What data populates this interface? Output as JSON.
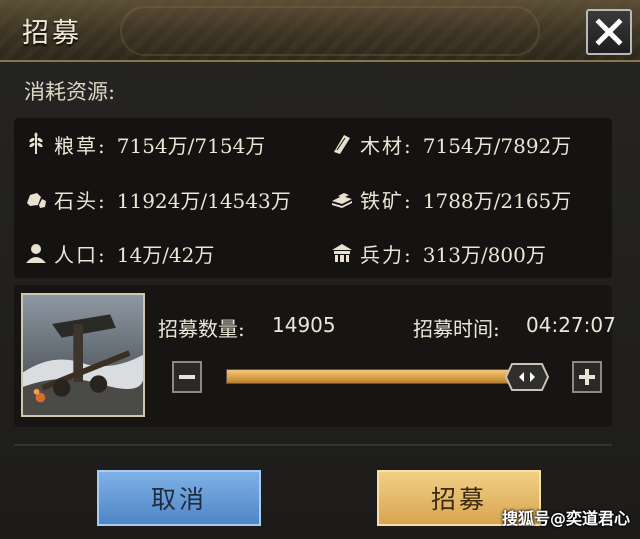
{
  "dialog": {
    "title": "招募",
    "close_icon": "close-icon"
  },
  "cost": {
    "label": "消耗资源:"
  },
  "resources": [
    {
      "icon": "grain-icon",
      "label": "粮草:",
      "value": "7154万/7154万"
    },
    {
      "icon": "wood-icon",
      "label": "木材:",
      "value": "7154万/7892万"
    },
    {
      "icon": "stone-icon",
      "label": "石头:",
      "value": "11924万/14543万"
    },
    {
      "icon": "iron-ore-icon",
      "label": "铁矿:",
      "value": "1788万/2165万"
    },
    {
      "icon": "population-icon",
      "label": "人口:",
      "value": "14万/42万"
    },
    {
      "icon": "troops-icon",
      "label": "兵力:",
      "value": "313万/800万"
    }
  ],
  "recruit": {
    "quantity_label": "招募数量:",
    "quantity_value": "14905",
    "time_label": "招募时间:",
    "time_value": "04:27:07",
    "slider_fraction": 0.9
  },
  "buttons": {
    "cancel": "取消",
    "confirm": "招募"
  },
  "watermark": "搜狐号@奕道君心",
  "colors": {
    "accent_gold": "#d99d48",
    "cancel_blue": "#5e93d2",
    "confirm_gold": "#e3b465"
  }
}
